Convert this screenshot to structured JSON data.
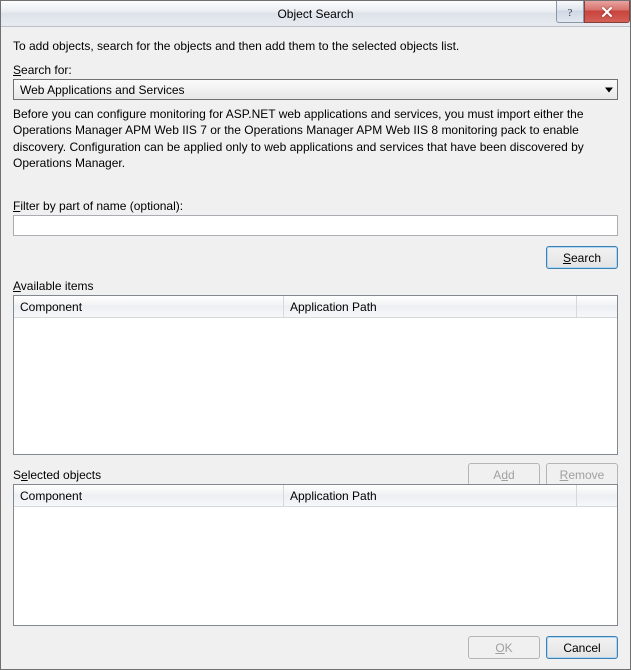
{
  "window": {
    "title": "Object Search"
  },
  "intro": "To add objects, search for the objects and then add them to the selected objects list.",
  "searchFor": {
    "label": "Search for:",
    "value": "Web Applications and Services"
  },
  "description": "Before you can configure monitoring for ASP.NET web applications and services, you must import either the Operations Manager APM Web IIS 7 or the Operations Manager APM Web IIS 8 monitoring pack to enable discovery. Configuration can be applied only to web applications and services that have been discovered by Operations Manager.",
  "filter": {
    "label": "Filter by part of name (optional):",
    "value": ""
  },
  "buttons": {
    "search": "Search",
    "add": "Add",
    "remove": "Remove",
    "ok": "OK",
    "cancel": "Cancel"
  },
  "sections": {
    "available": "Available items",
    "selected": "Selected objects"
  },
  "columns": {
    "component": "Component",
    "appPath": "Application Path"
  }
}
